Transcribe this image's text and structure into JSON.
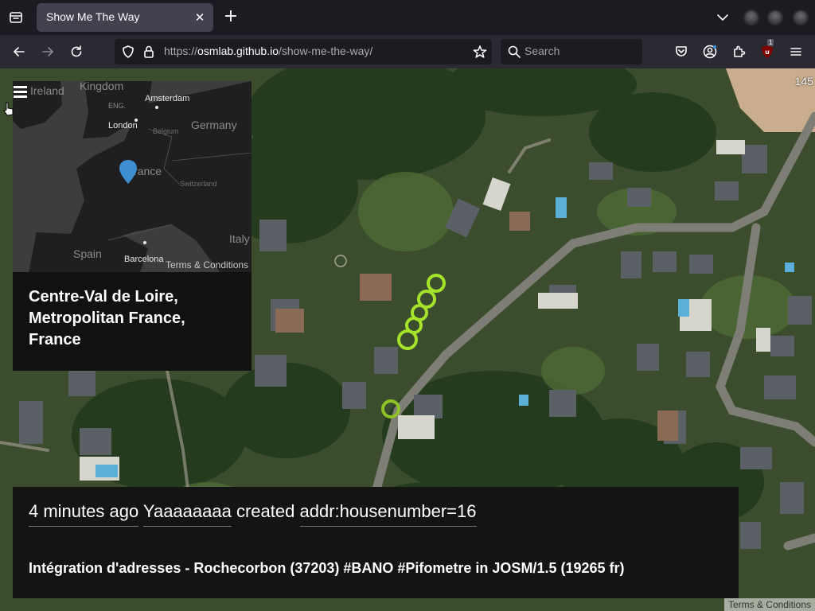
{
  "browser": {
    "tab_title": "Show Me The Way",
    "url_scheme": "https://",
    "url_host": "osmlab.github.io",
    "url_path": "/show-me-the-way/",
    "search_placeholder": "Search",
    "extension_badge": "1",
    "icons": [
      "tab-list-icon",
      "close-icon",
      "plus-icon",
      "chevron-down-icon",
      "back-arrow-icon",
      "forward-arrow-icon",
      "reload-icon",
      "shield-icon",
      "lock-icon",
      "star-icon",
      "search-icon",
      "pocket-icon",
      "account-icon",
      "extensions-icon",
      "ublock-icon",
      "menu-icon"
    ]
  },
  "map": {
    "top_counter": "145",
    "attribution": "Terms & Conditions",
    "edit_marker_color": "#a5e22a"
  },
  "overview": {
    "labels": {
      "ireland": "Ireland",
      "kingdom": "Kingdom",
      "eng": "ENG.",
      "amsterdam": "Amsterdam",
      "london": "London",
      "belgium": "Belgium",
      "germany": "Germany",
      "france": "rance",
      "switzerland": "Switzerland",
      "spain": "Spain",
      "barcelona": "Barcelona",
      "italy": "Italy"
    },
    "terms": "Terms & Conditions",
    "pin_color": "#3d8fd1",
    "region": "Centre-Val de Loire, Metropolitan France, France"
  },
  "change": {
    "time": "4 minutes ago",
    "user": "Yaaaaaaaa",
    "action": "created",
    "tag": "addr:housenumber=16",
    "comment": "Intégration d'adresses - Rochecorbon (37203) #BANO #Pifometre in JOSM/1.5 (19265 fr)"
  }
}
